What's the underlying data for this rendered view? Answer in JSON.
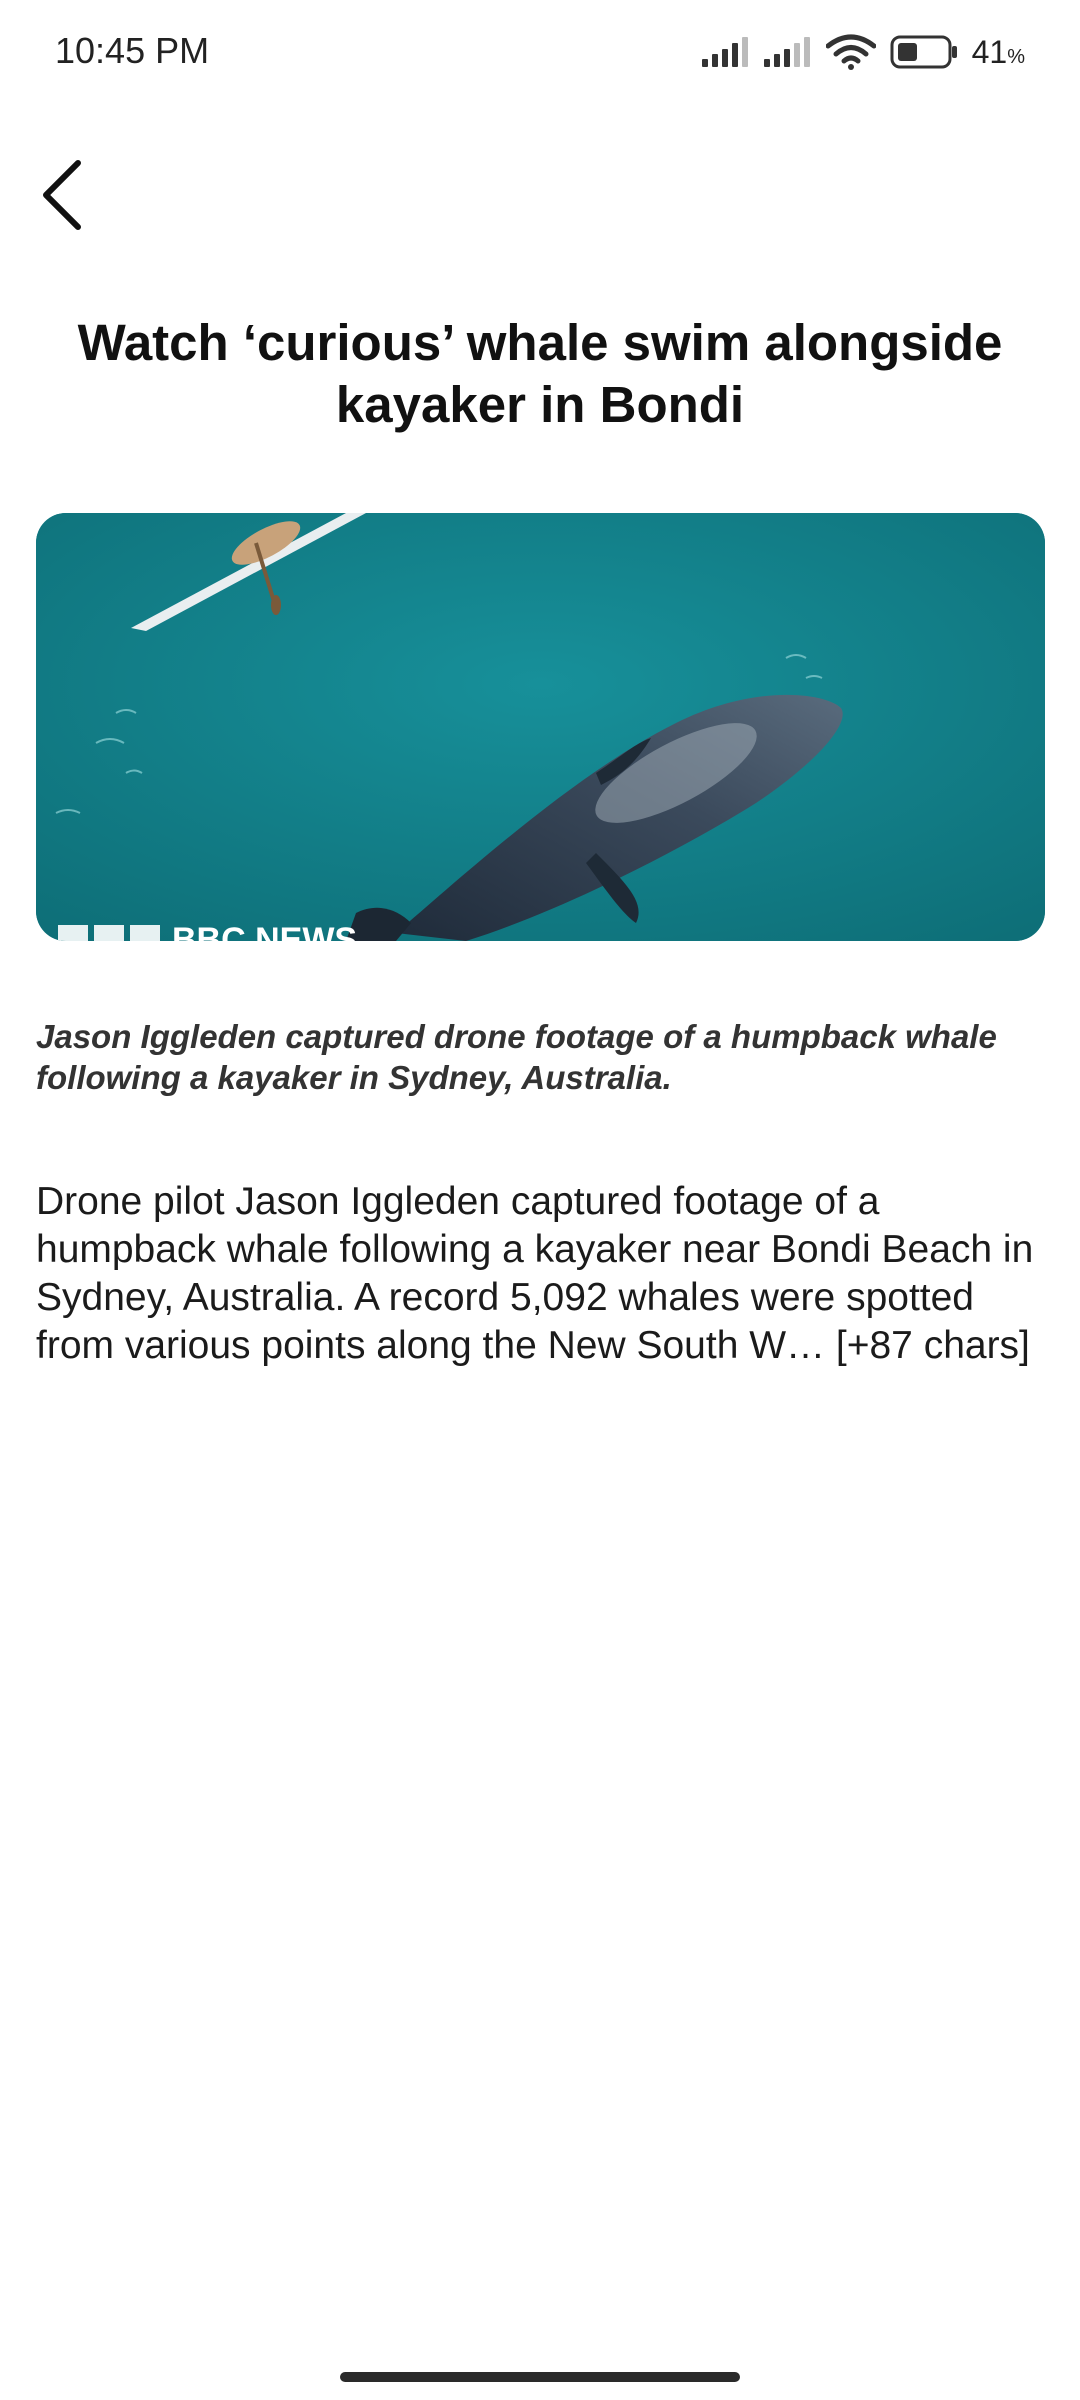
{
  "status_bar": {
    "time": "10:45 PM",
    "battery_percent": "41",
    "battery_percent_sign": "%",
    "battery_level": 0.41,
    "icons": [
      "signal-icon",
      "signal-icon",
      "wifi-icon",
      "battery-icon"
    ]
  },
  "header": {
    "back_icon": "chevron-left-icon"
  },
  "article": {
    "title": "Watch ‘curious’ whale swim alongside kayaker in Bondi",
    "hero_image": {
      "watermark_text": "BBC NEWS",
      "colors": {
        "water": "#127d86",
        "whale": "#2b3a4a"
      }
    },
    "caption": "Jason Iggleden captured drone footage of a humpback whale following a kayaker in Sydney, Australia.",
    "body": "Drone pilot Jason Iggleden captured footage of a humpback whale following a kayaker near Bondi Beach in Sydney, Australia. A record 5,092 whales were spotted from various points along the New South W… [+87 chars]"
  }
}
